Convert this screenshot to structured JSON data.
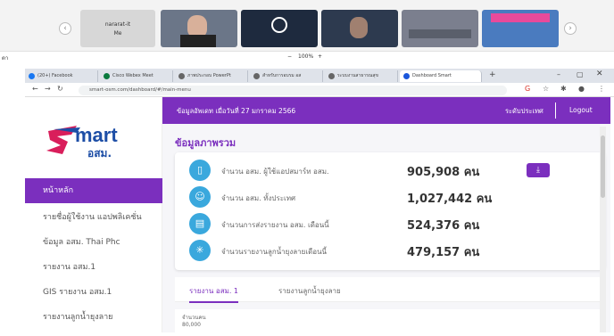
{
  "meeting": {
    "participant_name": "nararat-it",
    "participant_sub": "Me",
    "zoom_label": "100%",
    "zoom_minus": "−",
    "zoom_plus": "+",
    "left_id": "ตา"
  },
  "browser": {
    "tabs": [
      {
        "label": "(20+) Facebook",
        "color": "#1877f2"
      },
      {
        "label": "Cisco Webex Meet",
        "color": "#0b7a3e"
      },
      {
        "label": "ภาพประกอบ PowerPt",
        "color": "#666666"
      },
      {
        "label": "สำหรับการอบรม อส",
        "color": "#666666"
      },
      {
        "label": "ระบบงานสาธารณสุข",
        "color": "#666666"
      },
      {
        "label": "Dashboard Smart",
        "color": "#1a56db"
      }
    ],
    "url": "smart-osm.com/dashboard/#/main-menu"
  },
  "app": {
    "logo_main": "mart",
    "logo_sub": "อสม.",
    "topbar_text": "ข้อมูลอัพเดท เมื่อวันที่ 27 มกราคม 2566",
    "level_label": "ระดับประเทศ",
    "logout_label": "Logout",
    "sidebar": [
      {
        "label": "หน้าหลัก",
        "active": true
      },
      {
        "label": "รายชื่อผู้ใช้งาน แอปพลิเคชั่น",
        "active": false
      },
      {
        "label": "ข้อมูล อสม. Thai Phc",
        "active": false
      },
      {
        "label": "รายงาน อสม.1",
        "active": false
      },
      {
        "label": "GIS รายงาน อสม.1",
        "active": false
      },
      {
        "label": "รายงานลูกน้ำยุงลาย",
        "active": false
      }
    ],
    "section_title": "ข้อมูลภาพรวม",
    "stats": [
      {
        "label": "จำนวน อสม. ผู้ใช้แอปสมาร์ท อสม.",
        "value": "905,908 คน",
        "icon": "phone-icon"
      },
      {
        "label": "จำนวน อสม. ทั้งประเทศ",
        "value": "1,027,442 คน",
        "icon": "users-icon"
      },
      {
        "label": "จำนวนการส่งรายงาน อสม. เดือนนี้",
        "value": "524,376 คน",
        "icon": "report-icon"
      },
      {
        "label": "จำนวนรายงานลูกน้ำยุงลายเดือนนี้",
        "value": "479,157 คน",
        "icon": "mosquito-icon"
      }
    ],
    "report_tabs": [
      "รายงาน อสม. 1",
      "รายงานลูกน้ำยุงลาย"
    ],
    "chart_caption": "จำนวนคน",
    "chart_tick": "80,000"
  },
  "colors": {
    "brand": "#7b2fbe",
    "icon": "#3aa8dd"
  }
}
